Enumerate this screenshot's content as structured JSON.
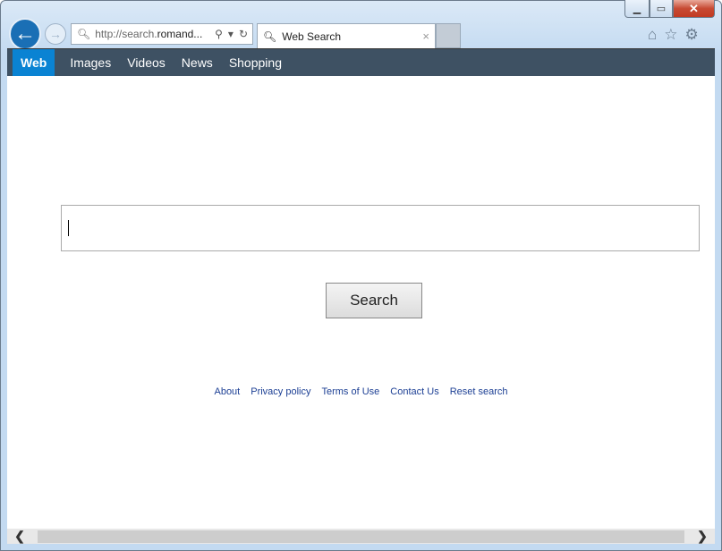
{
  "browser": {
    "url_prefix": "http://search.",
    "url_domain": "romand...",
    "tab_title": "Web Search",
    "close_tab": "×",
    "minimize": "▁",
    "maximize": "▭",
    "close": "✕",
    "back": "←",
    "forward": "→"
  },
  "nav": {
    "items": [
      {
        "label": "Web",
        "active": true
      },
      {
        "label": "Images"
      },
      {
        "label": "Videos"
      },
      {
        "label": "News"
      },
      {
        "label": "Shopping"
      }
    ],
    "active_color": "#0a83d3",
    "bar_color": "#3e5163"
  },
  "search": {
    "value": "",
    "button": "Search"
  },
  "footer": {
    "links": [
      "About",
      "Privacy policy",
      "Terms of Use",
      "Contact Us",
      "Reset search"
    ]
  },
  "scrollbar": {
    "left": "❮",
    "right": "❯"
  }
}
